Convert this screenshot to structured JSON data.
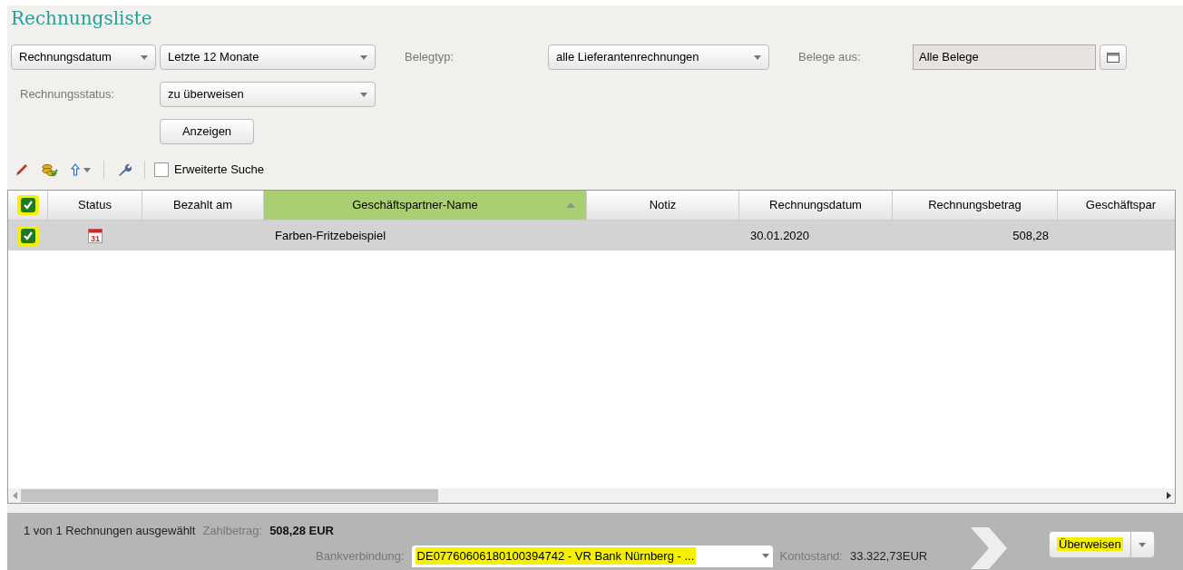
{
  "title": "Rechnungsliste",
  "filters": {
    "date_field": "Rechnungsdatum",
    "period": "Letzte 12 Monate",
    "doc_type_label": "Belegtyp:",
    "doc_type": "alle Lieferantenrechnungen",
    "source_label": "Belege aus:",
    "source": "Alle Belege",
    "status_label": "Rechnungsstatus:",
    "status": "zu überweisen",
    "show_button": "Anzeigen"
  },
  "toolbar": {
    "extended_search": {
      "label": "Erweiterte Suche",
      "checked": false
    }
  },
  "table": {
    "all_checked": true,
    "columns": [
      {
        "label": "Status",
        "sorted": false
      },
      {
        "label": "Bezahlt am",
        "sorted": false
      },
      {
        "label": "Geschäftspartner-Name",
        "sorted": true
      },
      {
        "label": "Notiz",
        "sorted": false
      },
      {
        "label": "Rechnungsdatum",
        "sorted": false
      },
      {
        "label": "Rechnungsbetrag",
        "sorted": false
      },
      {
        "label": "Geschäftspar",
        "sorted": false
      }
    ],
    "rows": [
      {
        "checked": true,
        "selected": true,
        "status_day": "31",
        "paid_on": "",
        "partner": "Farben-Fritzebeispiel",
        "note": "",
        "date": "30.01.2020",
        "amount": "508,28"
      }
    ]
  },
  "footer": {
    "selection": "1 von 1 Rechnungen ausgewählt",
    "payment_label": "Zahlbetrag:",
    "payment": "508,28 EUR",
    "bank_label": "Bankverbindung:",
    "bank": "DE07760606180100394742 - VR Bank Nürnberg - ...",
    "balance_label": "Kontostand:",
    "balance": "33.322,73EUR",
    "transfer_button": "Überweisen"
  }
}
